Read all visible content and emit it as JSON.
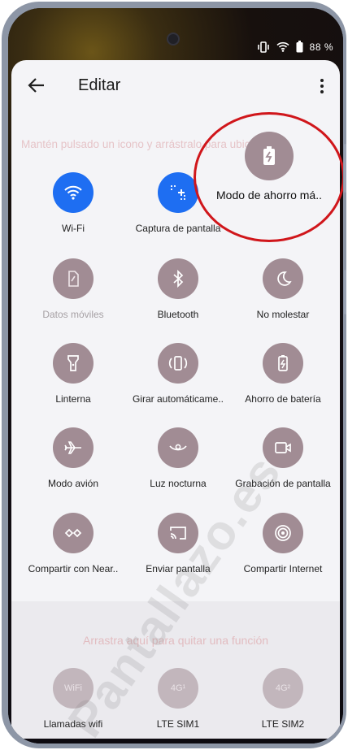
{
  "status": {
    "battery": "88 %"
  },
  "header": {
    "title": "Editar"
  },
  "hint": "Mantén pulsado un icono y arrástralo para ubicarlo",
  "drag_preview": {
    "label": "Modo de ahorro má.."
  },
  "tiles": [
    {
      "label": "Wi-Fi",
      "icon": "wifi-icon",
      "active": true
    },
    {
      "label": "Captura de pantalla",
      "icon": "screenshot-icon",
      "active": true
    },
    {
      "label": "Datos móviles",
      "icon": "mobile-data-icon",
      "dim": true
    },
    {
      "label": "Bluetooth",
      "icon": "bluetooth-icon"
    },
    {
      "label": "No molestar",
      "icon": "moon-icon"
    },
    {
      "label": "Linterna",
      "icon": "flashlight-icon"
    },
    {
      "label": "Girar automáticame..",
      "icon": "auto-rotate-icon"
    },
    {
      "label": "Ahorro de batería",
      "icon": "battery-saver-icon"
    },
    {
      "label": "Modo avión",
      "icon": "airplane-icon"
    },
    {
      "label": "Luz nocturna",
      "icon": "eye-icon"
    },
    {
      "label": "Grabación de pantalla",
      "icon": "screen-record-icon"
    },
    {
      "label": "Compartir con Near..",
      "icon": "nearby-share-icon"
    },
    {
      "label": "Enviar pantalla",
      "icon": "cast-icon"
    },
    {
      "label": "Compartir Internet",
      "icon": "hotspot-icon"
    }
  ],
  "removed": {
    "hint": "Arrastra aquí para quitar una función",
    "tiles": [
      {
        "label": "Llamadas wifi",
        "icon": "wifi-calling-icon",
        "glyph": "WiFi"
      },
      {
        "label": "LTE SIM1",
        "icon": "lte-sim1-icon",
        "glyph": "4G¹"
      },
      {
        "label": "LTE SIM2",
        "icon": "lte-sim2-icon",
        "glyph": "4G²"
      }
    ]
  },
  "watermark": "Pantallazo.es",
  "colors": {
    "active": "#1e6ef2",
    "inactive": "#a18c94",
    "highlight": "#d0161b"
  }
}
